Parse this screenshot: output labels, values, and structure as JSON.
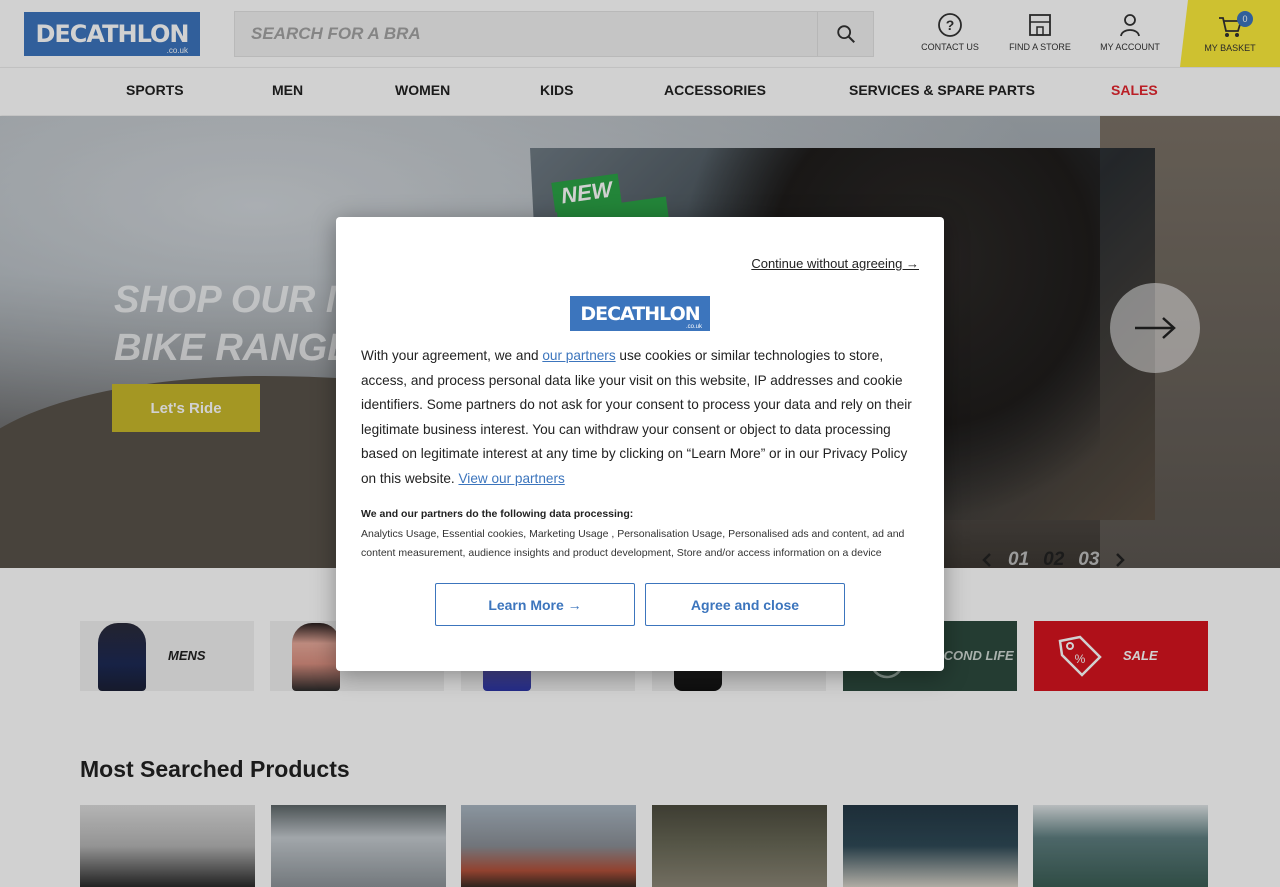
{
  "header": {
    "logo_text": "DECATHLON",
    "logo_sub": ".co.uk",
    "search_placeholder": "SEARCH FOR A BRA",
    "contact_label": "CONTACT US",
    "store_label": "FIND A STORE",
    "account_label": "MY ACCOUNT",
    "basket_label": "MY BASKET",
    "basket_count": "0"
  },
  "nav": {
    "items": [
      "SPORTS",
      "MEN",
      "WOMEN",
      "KIDS",
      "ACCESSORIES",
      "SERVICES & SPARE PARTS",
      "SALES"
    ]
  },
  "hero": {
    "title_line1": "SHOP OUR MO",
    "title_line2": "BIKE RANGE",
    "cta_label": "Let's Ride",
    "tag": "NEW",
    "slides": [
      "01",
      "02",
      "03"
    ],
    "active_slide": "02"
  },
  "tiles": [
    {
      "label": "MENS"
    },
    {
      "label": ""
    },
    {
      "label": ""
    },
    {
      "label": ""
    },
    {
      "label": "ECOND LIFE"
    },
    {
      "label": "SALE"
    }
  ],
  "section": {
    "title": "Most Searched Products"
  },
  "modal": {
    "continue_label": "Continue without agreeing →",
    "logo_text": "DECATHLON",
    "logo_sub": ".co.uk",
    "body_pre": "With your agreement, we and ",
    "partners_link": "our partners",
    "body_post": " use cookies or similar technologies to store, access, and process personal data like your visit on this website, IP addresses and cookie identifiers. Some partners do not ask for your consent to process your data and rely on their legitimate business interest. You can withdraw your consent or object to data processing based on legitimate interest at any time by clicking on “Learn More” or in our Privacy Policy on this website. ",
    "view_partners_link": "View our partners",
    "processing_title": "We and our partners do the following data processing:",
    "processing_list": "Analytics Usage, Essential cookies, Marketing Usage , Personalisation Usage, Personalised ads and content, ad and content measurement, audience insights and product development, Store and/or access information on a device",
    "learn_more_label": "Learn More →",
    "agree_label": "Agree and close"
  },
  "colors": {
    "brand_blue": "#3c75bd",
    "basket_yellow": "#fcec3b",
    "sale_red": "#d6141f",
    "nav_sales_red": "#e3262f"
  }
}
